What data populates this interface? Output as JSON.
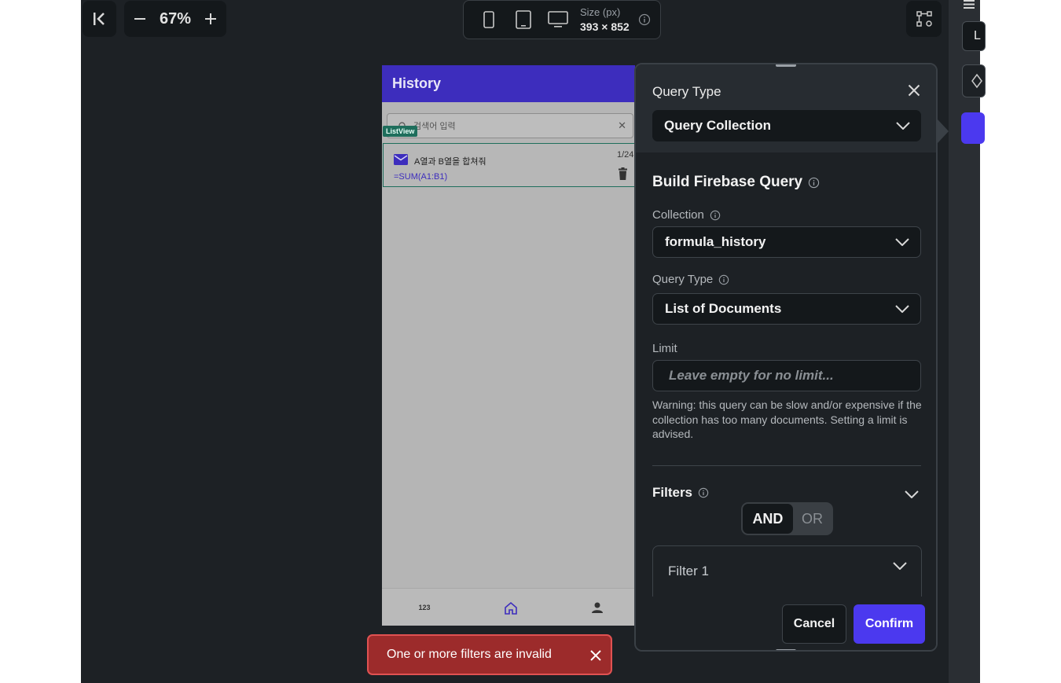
{
  "toolbar": {
    "zoom": "67%",
    "size_label": "Size (px)",
    "size_value": "393 × 852"
  },
  "phone": {
    "appbar_title": "History",
    "search_placeholder": "검색어 입력",
    "listview_badge": "ListView",
    "list_items": [
      {
        "title": "A열과 B열을 합쳐줘",
        "subtitle": "=SUM(A1:B1)",
        "counter": "1/24"
      }
    ],
    "nav_items": [
      "123",
      "home-icon",
      "person-icon"
    ],
    "accent": "#3d2dbd"
  },
  "dialog": {
    "header_title": "Query Type",
    "query_type_value": "Query Collection",
    "build_title": "Build Firebase Query",
    "collection_label": "Collection",
    "collection_value": "formula_history",
    "type_label": "Query Type",
    "type_value": "List of Documents",
    "limit_label": "Limit",
    "limit_placeholder": "Leave empty for no limit...",
    "warning": "Warning: this query can be slow and/or expensive if the collection has too many documents. Setting a limit is advised.",
    "filters_label": "Filters",
    "logic_and": "AND",
    "logic_or": "OR",
    "filter_1_label": "Filter 1",
    "cancel_label": "Cancel",
    "confirm_label": "Confirm",
    "confirm_color": "#4b39ef"
  },
  "toast": {
    "message": "One or more filters are invalid",
    "color": "#9c2b2b"
  },
  "right_panel": {
    "box_text": "L"
  }
}
